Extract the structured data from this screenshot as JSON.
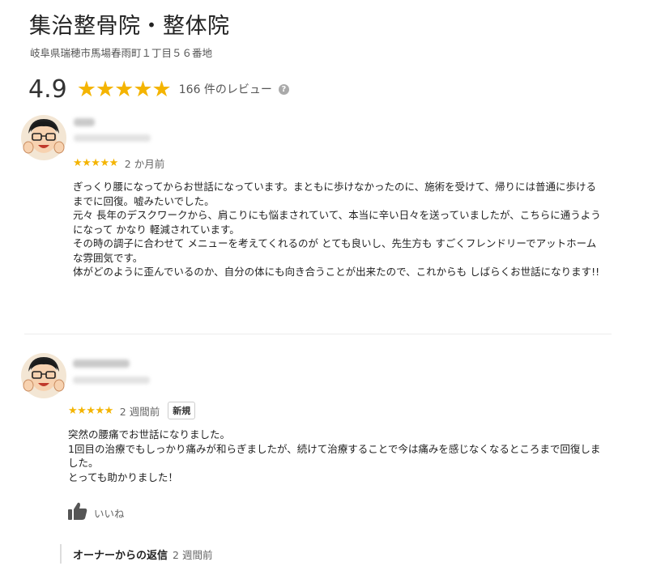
{
  "business": {
    "name": "集治整骨院・整体院",
    "address": "岐阜県瑞穂市馬場春雨町１丁目５６番地"
  },
  "rating": {
    "score": "4.9",
    "stars": "★★★★★",
    "review_count": "166 件のレビュー",
    "help_icon": "?"
  },
  "reviews": [
    {
      "stars": "★★★★★",
      "date": "2 か月前",
      "badge": "",
      "paragraphs": [
        "ぎっくり腰になってからお世話になっています。まともに歩けなかったのに、施術を受けて、帰りには普通に歩けるまでに回復。嘘みたいでした。",
        "元々 長年のデスクワークから、肩こりにも悩まされていて、本当に辛い日々を送っていましたが、こちらに通うようになって かなり 軽減されています。",
        "その時の調子に合わせて メニューを考えてくれるのが とても良いし、先生方も すごくフレンドリーでアットホームな雰囲気です。",
        "体がどのように歪んでいるのか、自分の体にも向き合うことが出来たので、これからも しばらくお世話になります!!"
      ]
    },
    {
      "stars": "★★★★★",
      "date": "2 週間前",
      "badge": "新規",
      "paragraphs": [
        "突然の腰痛でお世話になりました。",
        "1回目の治療でもしっかり痛みが和らぎましたが、続けて治療することで今は痛みを感じなくなるところまで回復しました。",
        "とっても助かりました！"
      ],
      "like_label": "いいね",
      "owner_reply": {
        "title": "オーナーからの返信",
        "date": "2 週間前"
      }
    }
  ]
}
